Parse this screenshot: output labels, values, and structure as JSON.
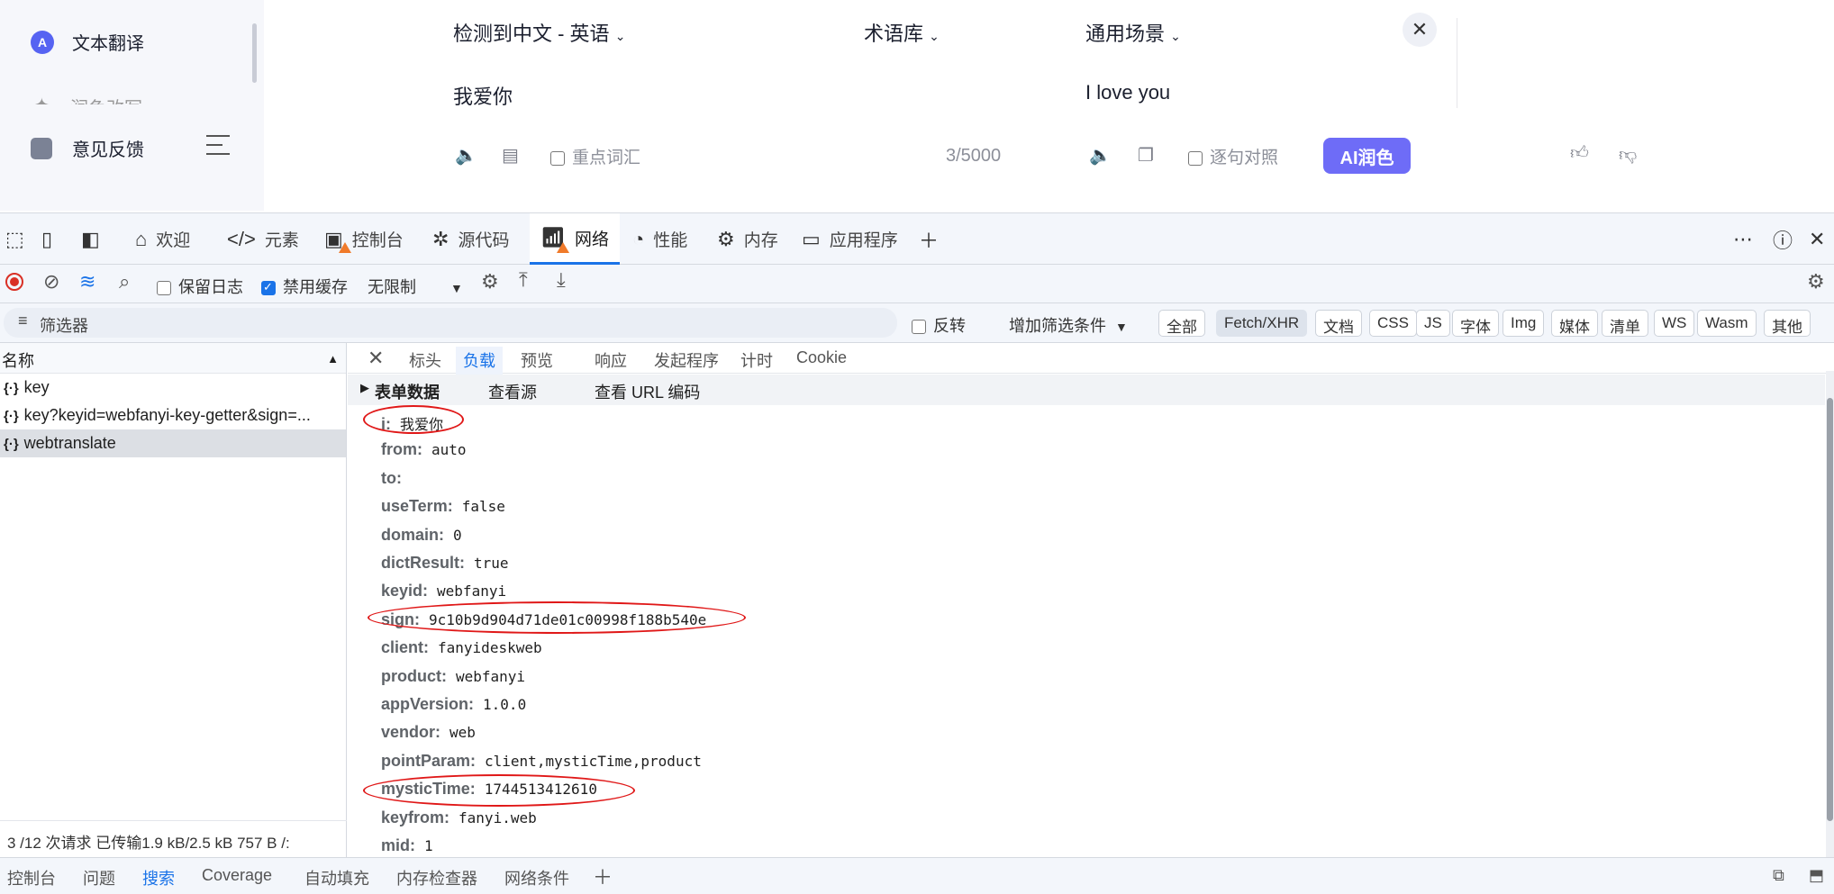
{
  "sidebar": {
    "items": [
      {
        "label": "文本翻译",
        "icon": "translate-a-icon"
      },
      {
        "label": "润色改写",
        "icon": "rewrite-icon"
      },
      {
        "label": "意见反馈",
        "icon": "feedback-icon"
      }
    ]
  },
  "translator": {
    "source_lang": "检测到中文 - 英语",
    "termbase": "术语库",
    "scenario": "通用场景",
    "source_text": "我爱你",
    "target_text": "I love you",
    "keyword_label": "重点词汇",
    "char_count": "3/5000",
    "sentence_align_label": "逐句对照",
    "ai_button": "AI润色"
  },
  "devtools": {
    "tabs": [
      "欢迎",
      "元素",
      "控制台",
      "源代码",
      "网络",
      "性能",
      "内存",
      "应用程序"
    ],
    "toolbar": {
      "preserve_log": "保留日志",
      "disable_cache": "禁用缓存",
      "throttle": "无限制"
    },
    "filter": {
      "placeholder": "筛选器",
      "invert": "反转",
      "more_filters": "增加筛选条件",
      "types": [
        "全部",
        "Fetch/XHR",
        "文档",
        "CSS",
        "JS",
        "字体",
        "Img",
        "媒体",
        "清单",
        "WS",
        "Wasm",
        "其他"
      ]
    },
    "requests": {
      "header": "名称",
      "items": [
        "key",
        "key?keyid=webfanyi-key-getter&sign=...",
        "webtranslate"
      ],
      "status": "3 /12 次请求  已传输1.9 kB/2.5 kB  757 B /:"
    },
    "detail_tabs": [
      "标头",
      "负载",
      "预览",
      "响应",
      "发起程序",
      "计时",
      "Cookie"
    ],
    "payload": {
      "section": "表单数据",
      "view_source": "查看源",
      "view_url": "查看 URL 编码",
      "fields": [
        [
          "i:",
          "我爱你"
        ],
        [
          "from:",
          "auto"
        ],
        [
          "to:",
          ""
        ],
        [
          "useTerm:",
          "false"
        ],
        [
          "domain:",
          "0"
        ],
        [
          "dictResult:",
          "true"
        ],
        [
          "keyid:",
          "webfanyi"
        ],
        [
          "sign:",
          "9c10b9d904d71de01c00998f188b540e"
        ],
        [
          "client:",
          "fanyideskweb"
        ],
        [
          "product:",
          "webfanyi"
        ],
        [
          "appVersion:",
          "1.0.0"
        ],
        [
          "vendor:",
          "web"
        ],
        [
          "pointParam:",
          "client,mysticTime,product"
        ],
        [
          "mysticTime:",
          "1744513412610"
        ],
        [
          "keyfrom:",
          "fanyi.web"
        ],
        [
          "mid:",
          "1"
        ]
      ]
    },
    "drawer_tabs": [
      "控制台",
      "问题",
      "搜索",
      "Coverage",
      "自动填充",
      "内存检查器",
      "网络条件"
    ]
  }
}
